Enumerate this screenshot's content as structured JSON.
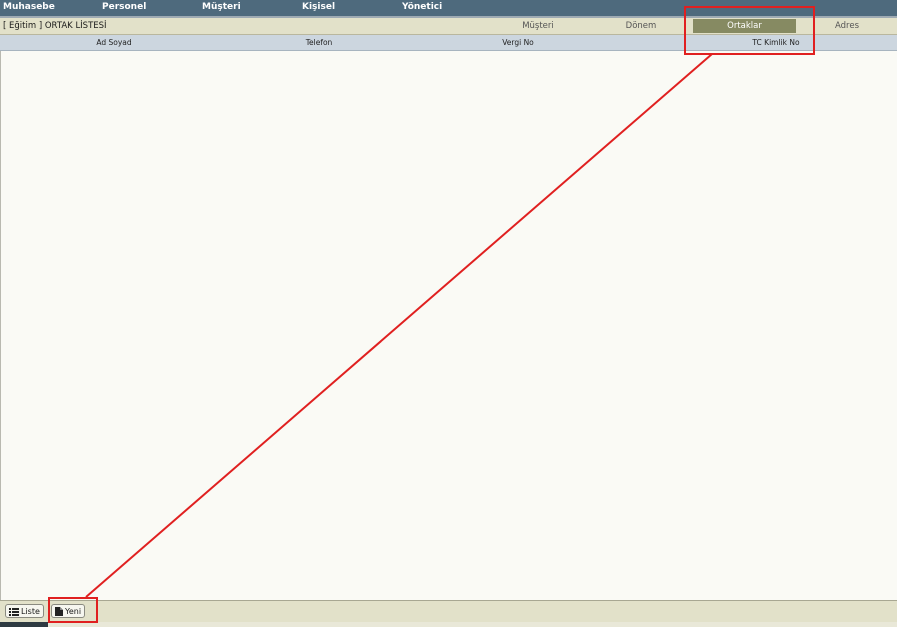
{
  "menu": {
    "items": [
      {
        "label": "Muhasebe"
      },
      {
        "label": "Personel"
      },
      {
        "label": "Müşteri"
      },
      {
        "label": "Kişisel"
      },
      {
        "label": "Yönetici"
      }
    ]
  },
  "page": {
    "title": "[ Eğitim ] ORTAK LİSTESİ"
  },
  "tabs": [
    {
      "label": "Müşteri",
      "active": false
    },
    {
      "label": "Dönem",
      "active": false
    },
    {
      "label": "Ortaklar",
      "active": true
    },
    {
      "label": "Adres",
      "active": false
    }
  ],
  "table": {
    "columns": [
      "Ad Soyad",
      "Telefon",
      "Vergi No",
      "TC Kimlik No"
    ],
    "rows": []
  },
  "footer": {
    "list_label": "Liste",
    "new_label": "Yeni"
  },
  "colors": {
    "menubar": "#4e6a7d",
    "titlebar": "#e2e1c9",
    "active_tab": "#868a62",
    "header_row": "#ccd6df",
    "annotation": "#e02020"
  }
}
